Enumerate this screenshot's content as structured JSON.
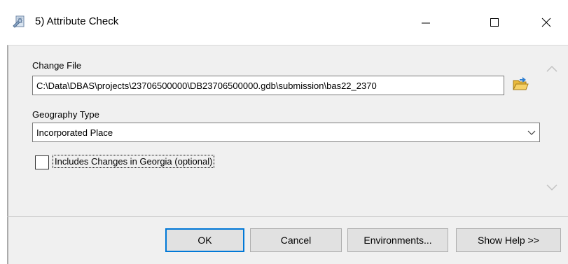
{
  "window": {
    "title": "5) Attribute Check",
    "icon": "toolbox-script-icon",
    "controls": {
      "minimize": "minimize-icon",
      "maximize": "maximize-icon",
      "close": "close-icon"
    }
  },
  "form": {
    "change_file": {
      "label": "Change File",
      "value": "C:\\Data\\DBAS\\projects\\23706500000\\DB23706500000.gdb\\submission\\bas22_2370",
      "browse_icon": "open-folder-icon"
    },
    "geography_type": {
      "label": "Geography Type",
      "value": "Incorporated Place"
    },
    "georgia": {
      "label": "Includes Changes in Georgia (optional)",
      "checked": false
    }
  },
  "buttons": {
    "ok": "OK",
    "cancel": "Cancel",
    "environments": "Environments...",
    "show_help": "Show Help >>"
  },
  "colors": {
    "panel": "#f0f0f0",
    "focus_border": "#0078d7",
    "button_face": "#e1e1e1"
  }
}
